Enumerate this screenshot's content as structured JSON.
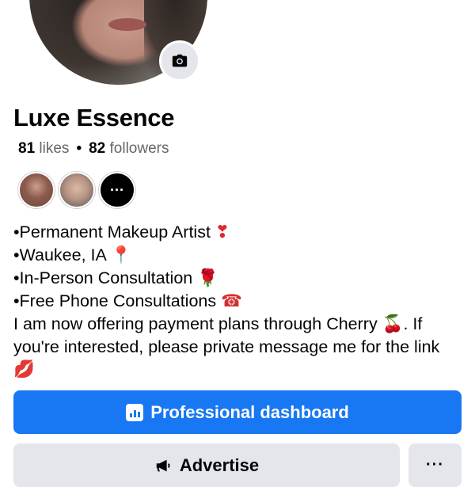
{
  "profile": {
    "name": "Luxe Essence",
    "likes_count": "81",
    "likes_label": "likes",
    "separator": "•",
    "followers_count": "82",
    "followers_label": "followers"
  },
  "friends_preview": {
    "more_label": "···"
  },
  "bio": {
    "lines": [
      {
        "text": "•Permanent Makeup Artist ",
        "emoji": "❣",
        "emoji_name": "heart-exclamation-icon"
      },
      {
        "text": "•Waukee, IA ",
        "emoji": "📍",
        "emoji_name": "round-pushpin-icon"
      },
      {
        "text": "•In-Person Consultation ",
        "emoji": "🌹",
        "emoji_name": "rose-icon"
      },
      {
        "text": "•Free Phone Consultations ",
        "emoji": "☎",
        "emoji_name": "telephone-icon"
      }
    ],
    "paragraph_text": "I am now offering payment plans through Cherry ",
    "paragraph_emoji_1": "🍒",
    "paragraph_after_emoji": ". If you're interested, please private message me for the link ",
    "paragraph_emoji_2": "💋"
  },
  "actions": {
    "primary_label": "Professional dashboard",
    "secondary_label": "Advertise",
    "more_label": "···"
  },
  "colors": {
    "primary_blue": "#1877f2",
    "secondary_gray": "#e4e6eb",
    "text_muted": "#65676b"
  }
}
